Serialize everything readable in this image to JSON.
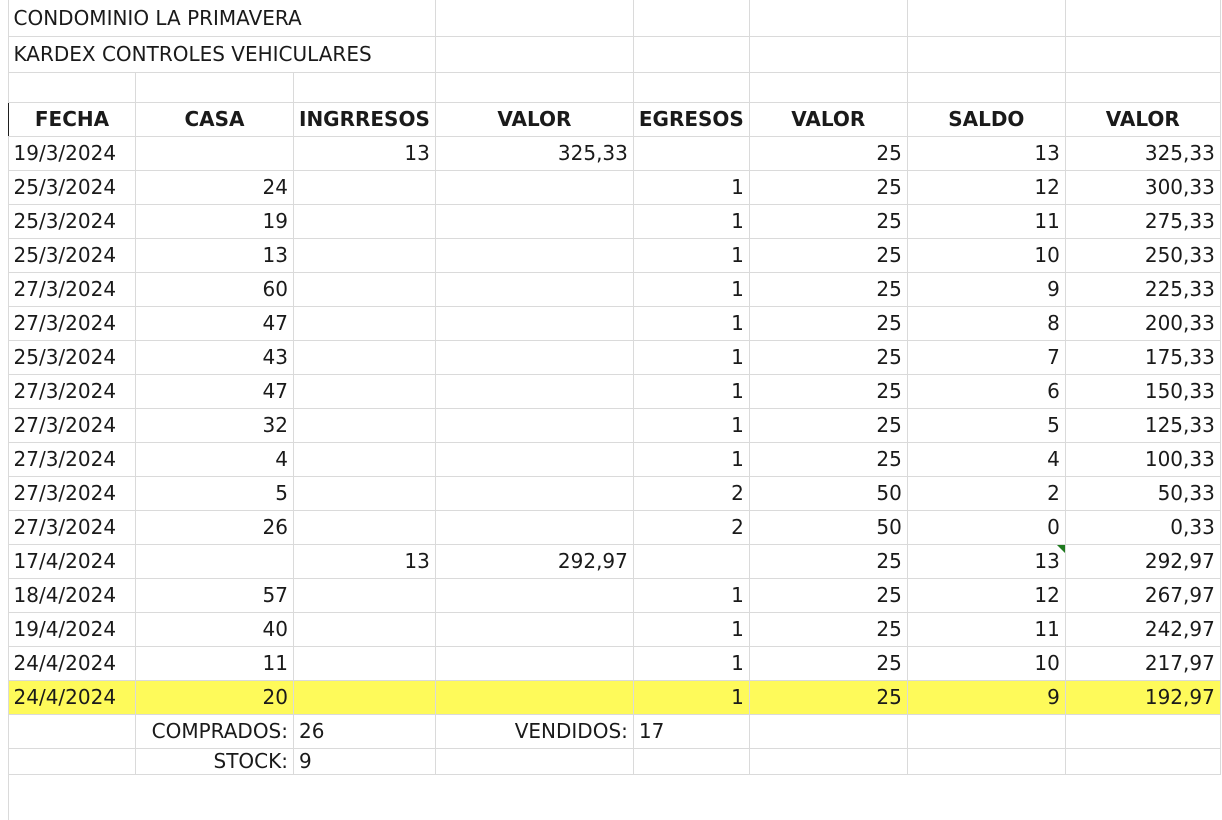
{
  "title1": "CONDOMINIO LA PRIMAVERA",
  "title2": "KARDEX CONTROLES VEHICULARES",
  "headers": [
    "FECHA",
    "CASA",
    "INGRRESOS",
    "VALOR",
    "EGRESOS",
    "VALOR",
    "SALDO",
    "VALOR"
  ],
  "rows": [
    [
      "19/3/2024",
      "",
      "13",
      "325,33",
      "",
      "25",
      "13",
      "325,33"
    ],
    [
      "25/3/2024",
      "24",
      "",
      "",
      "1",
      "25",
      "12",
      "300,33"
    ],
    [
      "25/3/2024",
      "19",
      "",
      "",
      "1",
      "25",
      "11",
      "275,33"
    ],
    [
      "25/3/2024",
      "13",
      "",
      "",
      "1",
      "25",
      "10",
      "250,33"
    ],
    [
      "27/3/2024",
      "60",
      "",
      "",
      "1",
      "25",
      "9",
      "225,33"
    ],
    [
      "27/3/2024",
      "47",
      "",
      "",
      "1",
      "25",
      "8",
      "200,33"
    ],
    [
      "25/3/2024",
      "43",
      "",
      "",
      "1",
      "25",
      "7",
      "175,33"
    ],
    [
      "27/3/2024",
      "47",
      "",
      "",
      "1",
      "25",
      "6",
      "150,33"
    ],
    [
      "27/3/2024",
      "32",
      "",
      "",
      "1",
      "25",
      "5",
      "125,33"
    ],
    [
      "27/3/2024",
      "4",
      "",
      "",
      "1",
      "25",
      "4",
      "100,33"
    ],
    [
      "27/3/2024",
      "5",
      "",
      "",
      "2",
      "50",
      "2",
      "50,33"
    ],
    [
      "27/3/2024",
      "26",
      "",
      "",
      "2",
      "50",
      "0",
      "0,33"
    ],
    [
      "17/4/2024",
      "",
      "13",
      "292,97",
      "",
      "25",
      "13",
      "292,97"
    ],
    [
      "18/4/2024",
      "57",
      "",
      "",
      "1",
      "25",
      "12",
      "267,97"
    ],
    [
      "19/4/2024",
      "40",
      "",
      "",
      "1",
      "25",
      "11",
      "242,97"
    ],
    [
      "24/4/2024",
      "11",
      "",
      "",
      "1",
      "25",
      "10",
      "217,97"
    ],
    [
      "24/4/2024",
      "20",
      "",
      "",
      "1",
      "25",
      "9",
      "192,97"
    ]
  ],
  "summary": {
    "comprados_label": "COMPRADOS:",
    "comprados_value": "26",
    "vendidos_label": "VENDIDOS:",
    "vendidos_value": "17",
    "stock_label": "STOCK:",
    "stock_value": "9"
  },
  "colors": {
    "highlight": "#fefa5a",
    "comment_marker": "#1f7a1f",
    "gridline": "#dadada"
  }
}
